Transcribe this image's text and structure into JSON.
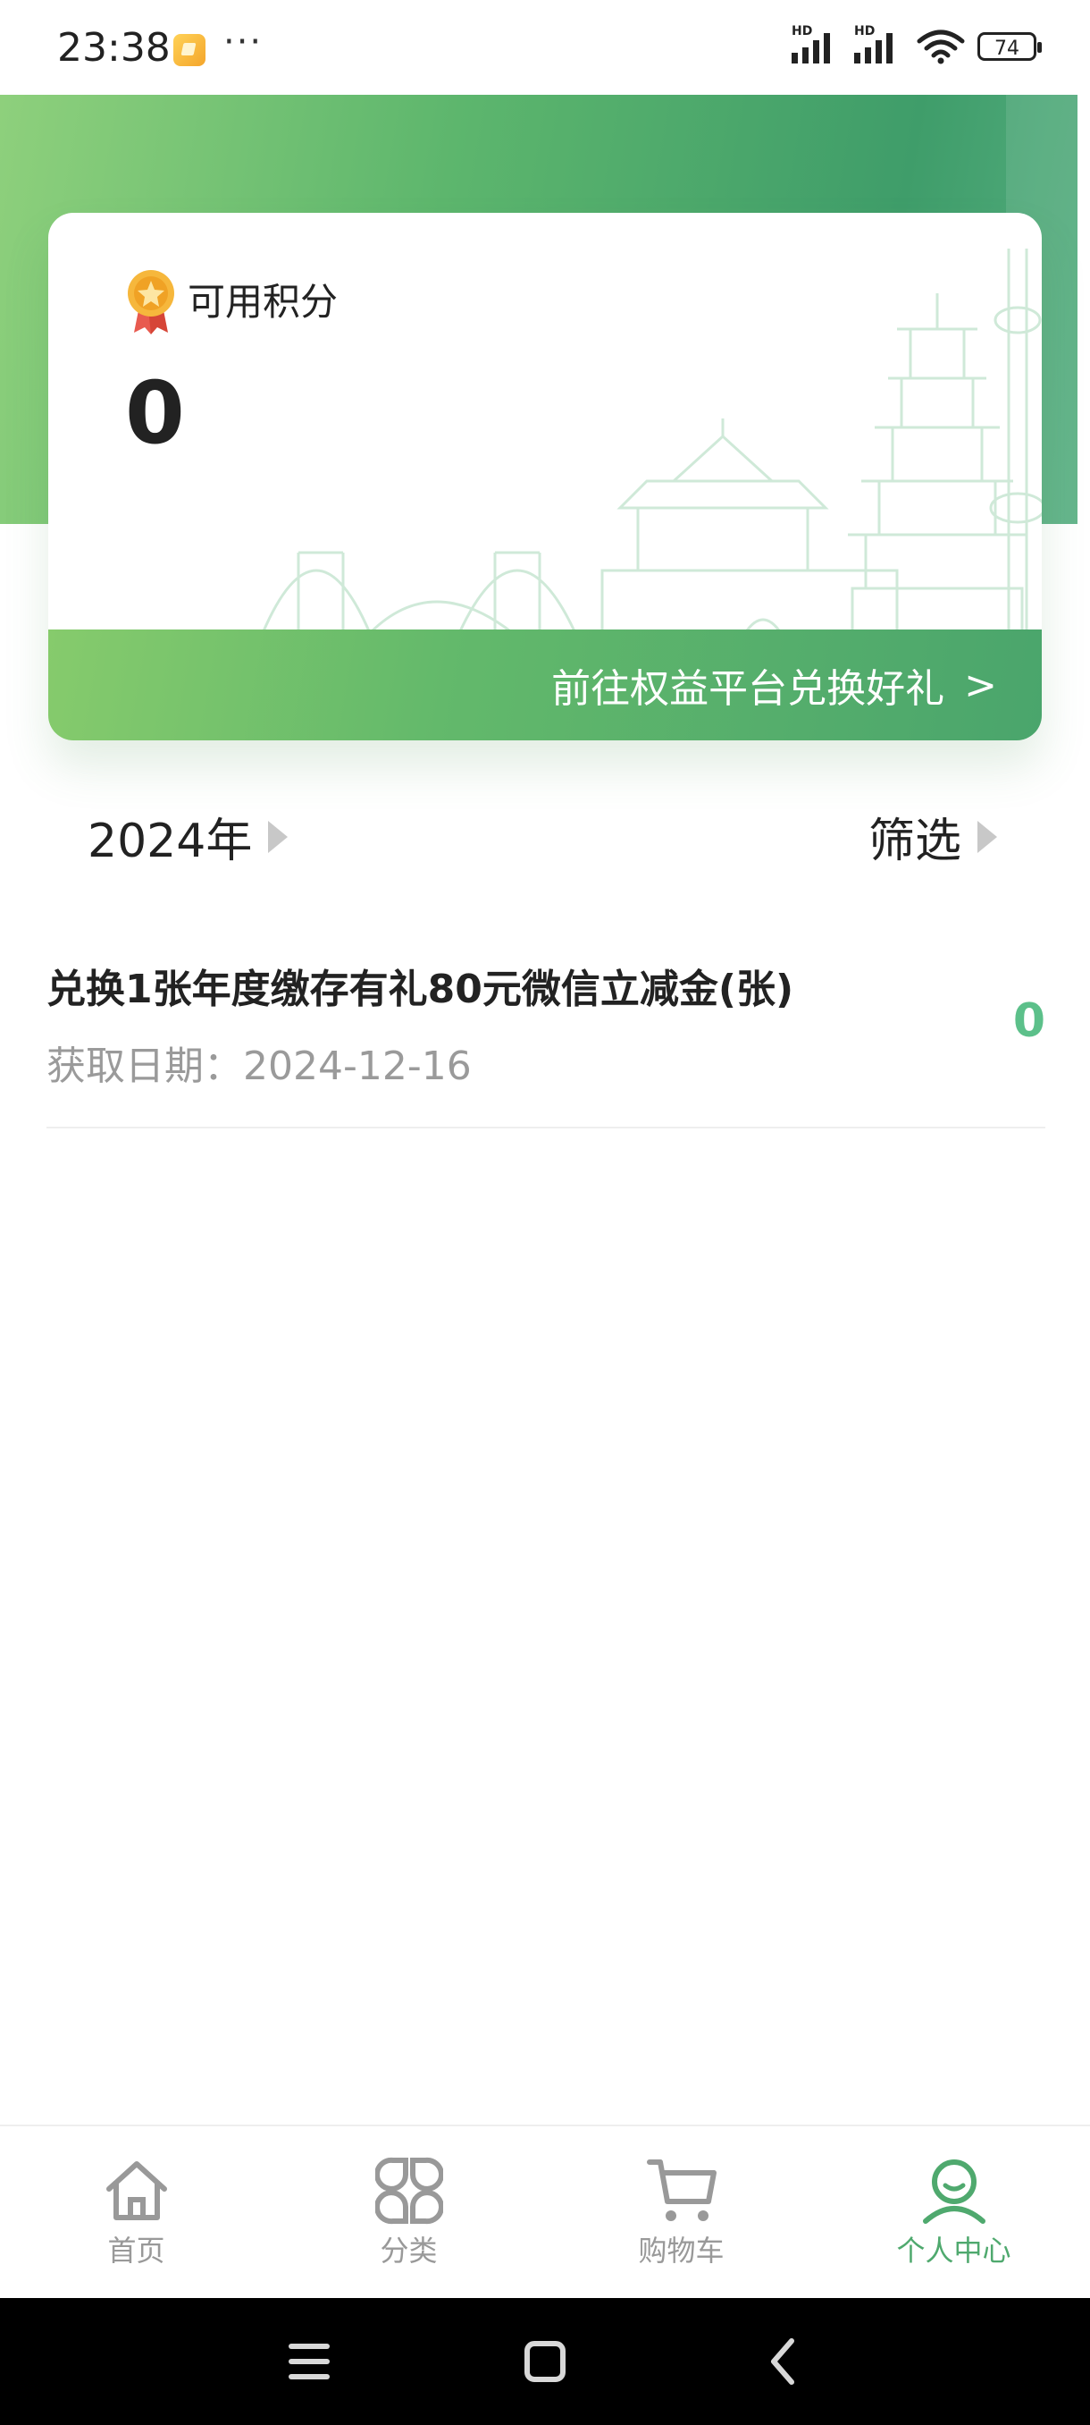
{
  "status_bar": {
    "time": "23:38",
    "dots": "···",
    "signal_label_1": "HD",
    "signal_label_2": "HD",
    "battery": "74",
    "icons": [
      "notification-app-icon",
      "signal-icon",
      "signal-icon",
      "wifi-icon",
      "battery-icon"
    ]
  },
  "points_card": {
    "label": "可用积分",
    "value": "0",
    "redeem_button": "前往权益平台兑换好礼",
    "redeem_chevron": ">"
  },
  "filter_row": {
    "year": "2024年",
    "filter": "筛选"
  },
  "records": [
    {
      "title": "兑换1张年度缴存有礼80元微信立减金(张)",
      "date": "获取日期：2024-12-16",
      "value": "0"
    }
  ],
  "bottom_nav": [
    {
      "label": "首页",
      "icon": "home-icon",
      "active": false
    },
    {
      "label": "分类",
      "icon": "category-icon",
      "active": false
    },
    {
      "label": "购物车",
      "icon": "cart-icon",
      "active": false
    },
    {
      "label": "个人中心",
      "icon": "profile-icon",
      "active": true
    }
  ],
  "colors": {
    "accent": "#4fa96e",
    "value_green": "#5cc08a",
    "hero_start": "#8ed07c",
    "hero_end": "#3f9d6a"
  }
}
